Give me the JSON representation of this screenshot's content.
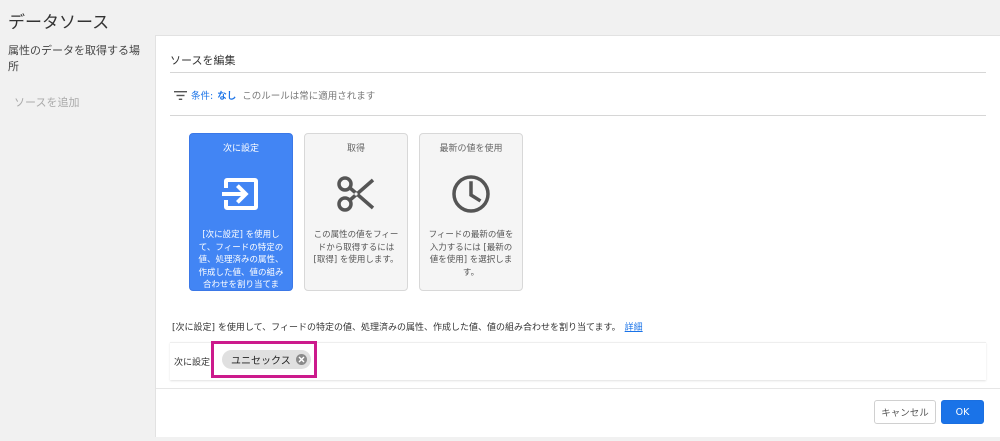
{
  "page": {
    "title": "データソース"
  },
  "sidebar": {
    "items": [
      {
        "label": "属性のデータを取得する場所"
      },
      {
        "label": "ソースを追加"
      }
    ]
  },
  "panel": {
    "heading": "ソースを編集",
    "condition": {
      "label": "条件:",
      "value": "なし",
      "text": "このルールは常に適用されます"
    },
    "cards": [
      {
        "title": "次に設定",
        "icon": "set-to-icon",
        "desc": "[次に設定] を使用して、フィードの特定の値、処理済みの属性、作成した値、値の組み合わせを割り当てます。",
        "selected": true
      },
      {
        "title": "取得",
        "icon": "scissors-icon",
        "desc": "この属性の値をフィードから取得するには [取得] を使用します。",
        "selected": false
      },
      {
        "title": "最新の値を使用",
        "icon": "clock-icon",
        "desc": "フィードの最新の値を入力するには [最新の値を使用] を選択します。",
        "selected": false
      }
    ],
    "info": {
      "text": "[次に設定] を使用して、フィードの特定の値、処理済みの属性、作成した値、値の組み合わせを割り当てます。",
      "link": "詳細"
    },
    "set_row": {
      "label": "次に設定",
      "chip": "ユニセックス"
    },
    "buttons": {
      "cancel": "キャンセル",
      "ok": "OK"
    }
  },
  "colors": {
    "accent": "#4285f4",
    "highlight": "#cc1a8c",
    "link": "#1a73e8"
  }
}
